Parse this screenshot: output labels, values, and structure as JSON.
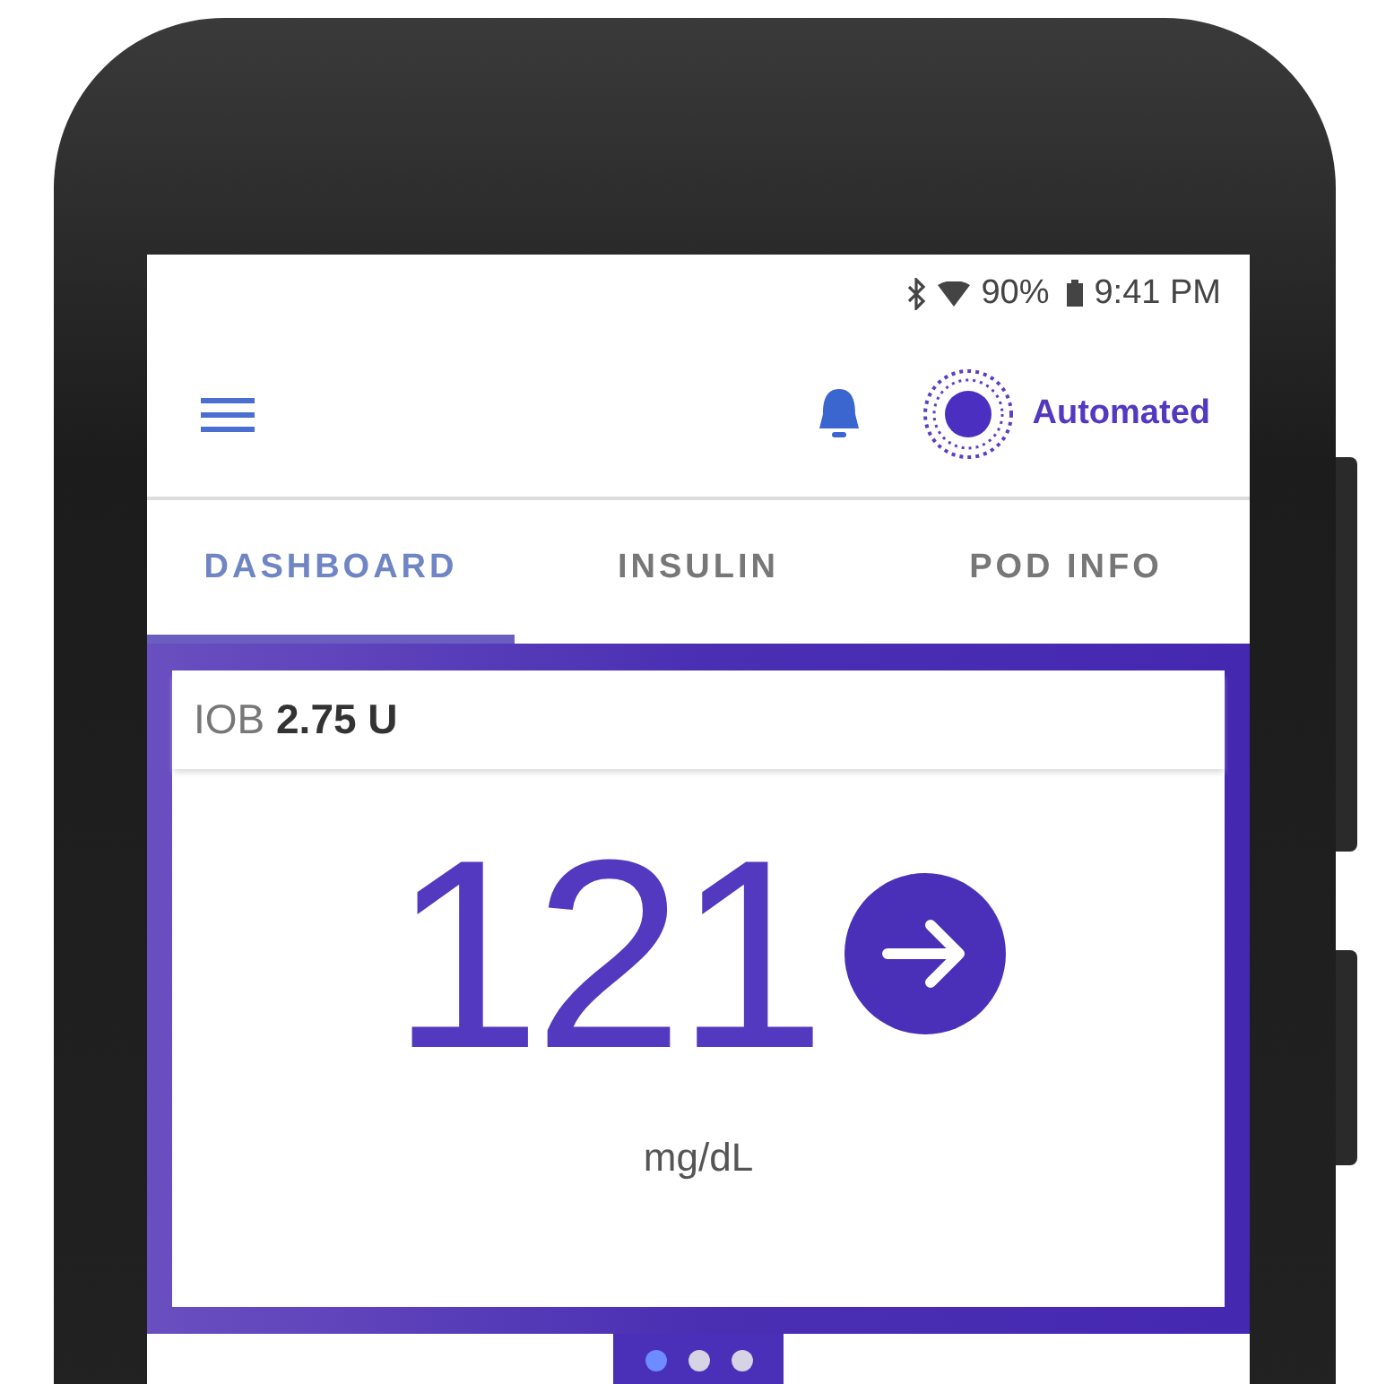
{
  "status_bar": {
    "battery": "90%",
    "time": "9:41 PM"
  },
  "app_bar": {
    "mode": "Automated"
  },
  "tabs": [
    {
      "label": "DASHBOARD",
      "selected": true
    },
    {
      "label": "INSULIN",
      "selected": false
    },
    {
      "label": "POD INFO",
      "selected": false
    }
  ],
  "iob": {
    "label": "IOB",
    "value": "2.75 U"
  },
  "glucose": {
    "value": "121",
    "unit": "mg/dL"
  },
  "pager": [
    {
      "selected": true
    },
    {
      "selected": false
    },
    {
      "selected": false
    }
  ]
}
